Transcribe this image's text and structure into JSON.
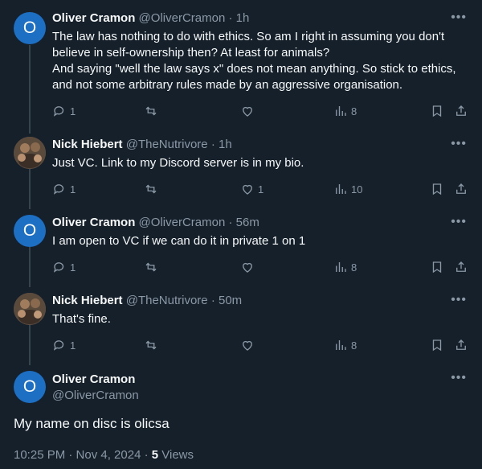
{
  "tweets": [
    {
      "name": "Oliver Cramon",
      "handle": "@OliverCramon",
      "time": "· 1h",
      "avatar_letter": "O",
      "lines": [
        "The law has nothing to do with ethics. So am I right in assuming you don't",
        "believe in self-ownership then? At least for animals?",
        "And saying \"well the law says x\" does not mean anything. So stick to ethics,",
        "and not some arbitrary rules made by an aggressive organisation."
      ],
      "replies": "1",
      "reposts": "",
      "likes": "",
      "views": "8"
    },
    {
      "name": "Nick Hiebert",
      "handle": "@TheNutrivore",
      "time": "· 1h",
      "lines": [
        "Just VC. Link to my Discord server is in my bio."
      ],
      "replies": "1",
      "reposts": "",
      "likes": "1",
      "views": "10"
    },
    {
      "name": "Oliver Cramon",
      "handle": "@OliverCramon",
      "time": "· 56m",
      "avatar_letter": "O",
      "lines": [
        "I am open to VC if we can do it in private 1 on 1"
      ],
      "replies": "1",
      "reposts": "",
      "likes": "",
      "views": "8"
    },
    {
      "name": "Nick Hiebert",
      "handle": "@TheNutrivore",
      "time": "· 50m",
      "lines": [
        "That's fine."
      ],
      "replies": "1",
      "reposts": "",
      "likes": "",
      "views": "8"
    }
  ],
  "main": {
    "name": "Oliver Cramon",
    "handle": "@OliverCramon",
    "avatar_letter": "O",
    "text": "My name on disc is olicsa",
    "timestamp": "10:25 PM · Nov 4, 2024 · ",
    "views_count": "5",
    "views_label": " Views"
  },
  "more_glyph": "•••",
  "icons": [
    "reply-icon",
    "repost-icon",
    "like-icon",
    "views-icon",
    "bookmark-icon",
    "share-icon"
  ],
  "colors": {
    "background": "#15202b",
    "secondary_text": "#8b98a5",
    "avatar_blue": "#1d6fc4"
  }
}
